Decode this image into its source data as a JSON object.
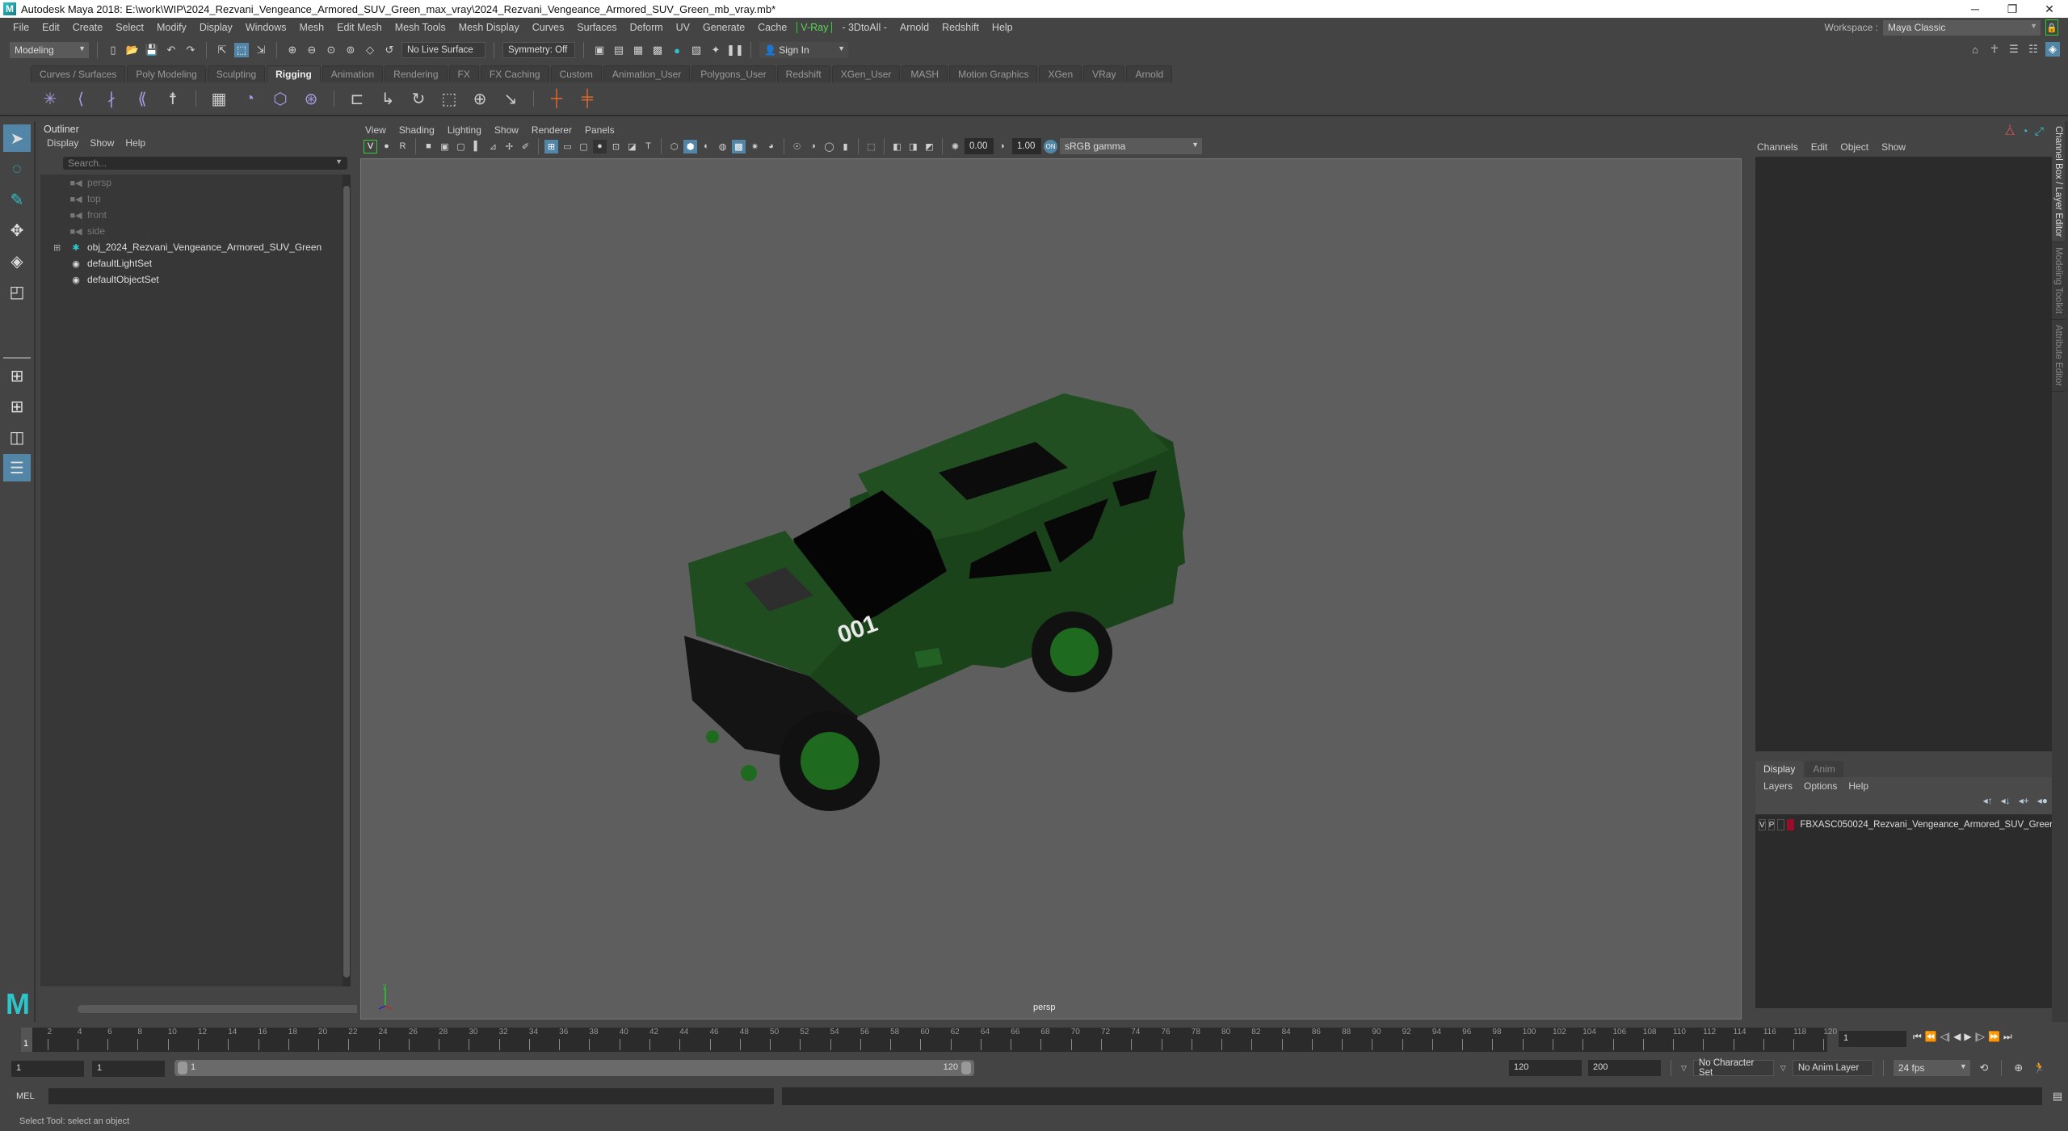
{
  "title_bar": {
    "title": "Autodesk Maya 2018: E:\\work\\WIP\\2024_Rezvani_Vengeance_Armored_SUV_Green_max_vray\\2024_Rezvani_Vengeance_Armored_SUV_Green_mb_vray.mb*",
    "minimize": "─",
    "restore": "❐",
    "close": "✕"
  },
  "menu_bar": [
    "File",
    "Edit",
    "Create",
    "Select",
    "Modify",
    "Display",
    "Windows",
    "Mesh",
    "Edit Mesh",
    "Mesh Tools",
    "Mesh Display",
    "Curves",
    "Surfaces",
    "Deform",
    "UV",
    "Generate",
    "Cache",
    "V-Ray",
    "- 3DtoAll -",
    "Arnold",
    "Redshift",
    "Help"
  ],
  "workspace": {
    "label": "Workspace :",
    "value": "Maya Classic"
  },
  "status_line": {
    "mode": "Modeling",
    "live_surface": "No Live Surface",
    "symmetry": "Symmetry: Off",
    "sign_in": "Sign In"
  },
  "shelf_tabs": [
    "Curves / Surfaces",
    "Poly Modeling",
    "Sculpting",
    "Rigging",
    "Animation",
    "Rendering",
    "FX",
    "FX Caching",
    "Custom",
    "Animation_User",
    "Polygons_User",
    "Redshift",
    "XGen_User",
    "MASH",
    "Motion Graphics",
    "XGen",
    "VRay",
    "Arnold"
  ],
  "active_shelf_tab": "Rigging",
  "shelf_icons": [
    "joint-tool",
    "ik-handle",
    "ik-spline",
    "create-ik-spline",
    "humanik",
    "paint-skin-weights",
    "bind-skin",
    "lattice",
    "cluster",
    "parent-constraint",
    "point-constraint",
    "orient-constraint",
    "scale-constraint",
    "aim-constraint",
    "pole-vector",
    "orange-cross",
    "orange-cross-link"
  ],
  "outliner": {
    "title": "Outliner",
    "menus": [
      "Display",
      "Show",
      "Help"
    ],
    "search_placeholder": "Search...",
    "items": [
      {
        "label": "persp",
        "type": "camera",
        "dim": true
      },
      {
        "label": "top",
        "type": "camera",
        "dim": true
      },
      {
        "label": "front",
        "type": "camera",
        "dim": true
      },
      {
        "label": "side",
        "type": "camera",
        "dim": true
      },
      {
        "label": "obj_2024_Rezvani_Vengeance_Armored_SUV_Green",
        "type": "group",
        "expandable": true
      },
      {
        "label": "defaultLightSet",
        "type": "set"
      },
      {
        "label": "defaultObjectSet",
        "type": "set"
      }
    ]
  },
  "viewport": {
    "menus": [
      "View",
      "Shading",
      "Lighting",
      "Show",
      "Renderer",
      "Panels"
    ],
    "exposure": "0.00",
    "gamma": "1.00",
    "color_space": "sRGB gamma",
    "camera_label": "persp",
    "model_badge": "001"
  },
  "channel_box": {
    "menus": [
      "Channels",
      "Edit",
      "Object",
      "Show"
    ]
  },
  "layer_editor": {
    "tabs": [
      "Display",
      "Anim"
    ],
    "active_tab": "Display",
    "menus": [
      "Layers",
      "Options",
      "Help"
    ],
    "layers": [
      {
        "v": "V",
        "p": "P",
        "name": "FBXASC050024_Rezvani_Vengeance_Armored_SUV_Greer",
        "color": "#9a0d2a"
      }
    ]
  },
  "side_tabs": [
    "Channel Box / Layer Editor",
    "Modeling Toolkit",
    "Attribute Editor"
  ],
  "timeline": {
    "ticks": [
      2,
      4,
      6,
      8,
      10,
      12,
      14,
      16,
      18,
      20,
      22,
      24,
      26,
      28,
      30,
      32,
      34,
      36,
      38,
      40,
      42,
      44,
      46,
      48,
      50,
      52,
      54,
      56,
      58,
      60,
      62,
      64,
      66,
      68,
      70,
      72,
      74,
      76,
      78,
      80,
      82,
      84,
      86,
      88,
      90,
      92,
      94,
      96,
      98,
      100,
      102,
      104,
      106,
      108,
      110,
      112,
      114,
      116,
      118,
      120
    ],
    "current_frame": "1",
    "current_marker": "1"
  },
  "range": {
    "start": "1",
    "anim_start": "1",
    "range_start": "1",
    "range_end": "120",
    "anim_end": "120",
    "end": "200",
    "character_set": "No Character Set",
    "anim_layer": "No Anim Layer",
    "fps": "24 fps"
  },
  "command_line": {
    "label": "MEL"
  },
  "help_line": "Select Tool: select an object",
  "colors": {
    "accent": "#5285a6",
    "vray_green": "#5ad45a",
    "maya_teal": "#2ec4c9",
    "car_body": "#1d4a1d",
    "viewport_bg": "#5e5e5e"
  }
}
